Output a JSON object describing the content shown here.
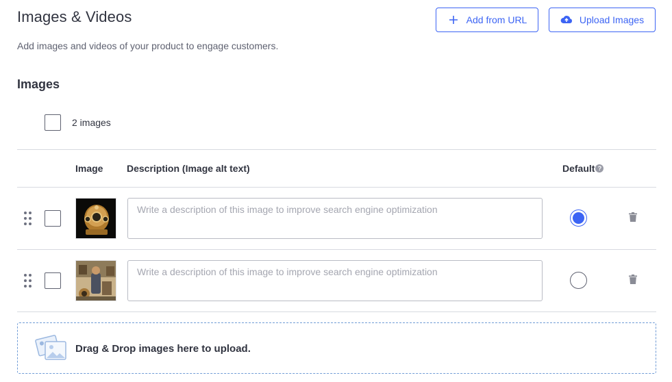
{
  "header": {
    "title": "Images & Videos",
    "subtitle": "Add images and videos of your product to engage customers.",
    "add_from_url_label": "Add from URL",
    "upload_images_label": "Upload Images"
  },
  "images_section": {
    "title": "Images",
    "count_label": "2 images",
    "columns": {
      "image": "Image",
      "description": "Description (Image alt text)",
      "default": "Default"
    },
    "rows": [
      {
        "thumbnail": "brass-diving-helmet",
        "description_value": "",
        "description_placeholder": "Write a description of this image to improve search engine optimization",
        "is_default": true
      },
      {
        "thumbnail": "diver-with-helmet-vintage",
        "description_value": "",
        "description_placeholder": "Write a description of this image to improve search engine optimization",
        "is_default": false
      }
    ]
  },
  "dropzone": {
    "text": "Drag & Drop images here to upload."
  },
  "colors": {
    "accent": "#3c64f4",
    "text": "#313440",
    "border": "#d7d9e0",
    "dropzone_border": "#6f9bd6"
  },
  "icons": {
    "add": "plus-icon",
    "upload": "cloud-upload-icon",
    "help": "question-circle-icon",
    "drag": "drag-handle-icon",
    "delete": "trash-icon",
    "dropzone": "image-gallery-icon"
  }
}
